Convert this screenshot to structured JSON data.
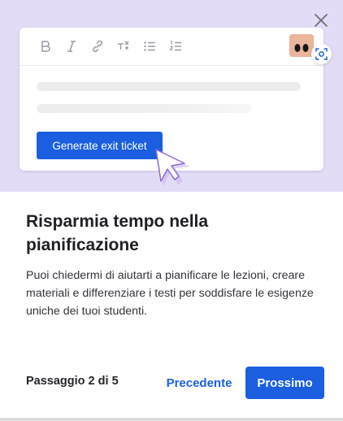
{
  "dialog": {
    "close_icon": "close-icon",
    "title": "Risparmia tempo nella pianificazione",
    "description": "Puoi chiedermi di aiutarti a pianificare le lezioni, creare materiali e differenziare i testi per soddisfare le esigenze uniche dei tuoi studenti.",
    "step_label": "Passaggio 2 di 5",
    "prev_label": "Precedente",
    "next_label": "Prossimo"
  },
  "illustration": {
    "toolbar_icons": [
      "bold-icon",
      "italic-icon",
      "link-icon",
      "clear-formatting-icon",
      "bulleted-list-icon",
      "numbered-list-icon"
    ],
    "generate_button_label": "Generate exit ticket",
    "avatar_icon": "avatar",
    "capture_icon": "screen-capture-icon",
    "cursor_icon": "pointer-cursor-icon"
  },
  "colors": {
    "accent": "#1b5fe0",
    "hero_background": "#e3dcf6",
    "text_primary": "#1f1f24"
  }
}
